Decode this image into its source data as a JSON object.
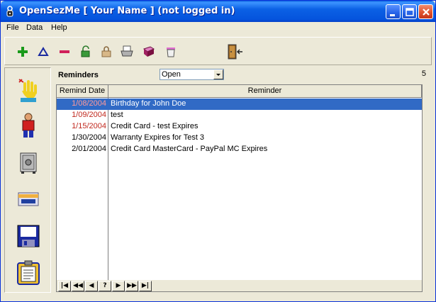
{
  "window": {
    "title": "OpenSezMe [ Your Name ] (not logged in)"
  },
  "menu": [
    "File",
    "Data",
    "Help"
  ],
  "toolbar": {
    "icons": [
      "add-icon",
      "edit-icon",
      "delete-icon",
      "unlock-icon",
      "lock-icon",
      "print-icon",
      "book-icon",
      "trash-icon",
      "exit-icon"
    ]
  },
  "sidenav": {
    "icons": [
      "reminders-icon",
      "person-icon",
      "safe-icon",
      "credit-card-icon",
      "disk-icon",
      "clipboard-icon"
    ]
  },
  "panel": {
    "title": "Reminders",
    "filter_value": "Open",
    "count": "5"
  },
  "grid": {
    "columns": [
      "Remind Date",
      "Reminder"
    ],
    "rows": [
      {
        "date": "1/08/2004",
        "text": "Birthday for John Doe",
        "overdue": true
      },
      {
        "date": "1/09/2004",
        "text": "test",
        "overdue": true
      },
      {
        "date": "1/15/2004",
        "text": "Credit Card  - test Expires",
        "overdue": true
      },
      {
        "date": "1/30/2004",
        "text": "Warranty Expires for Test 3",
        "overdue": false
      },
      {
        "date": "2/01/2004",
        "text": "Credit Card MasterCard - PayPal MC Expires",
        "overdue": false
      }
    ]
  },
  "navigator": [
    "|◀",
    "◀◀",
    "◀",
    "?",
    "▶",
    "▶▶",
    "▶|"
  ],
  "colors": {
    "overdue": "#c0281e",
    "selection": "#316ac5"
  }
}
